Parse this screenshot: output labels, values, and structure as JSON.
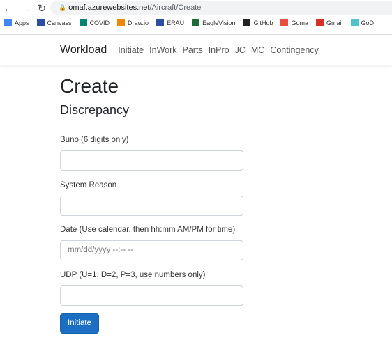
{
  "browser": {
    "url_host": "omaf.azurewebsites.net",
    "url_path": "/Aircraft/Create",
    "bookmarks": [
      {
        "label": "Apps",
        "color": "#4285f4"
      },
      {
        "label": "Canvass",
        "color": "#2b4ea2"
      },
      {
        "label": "COVID",
        "color": "#008373"
      },
      {
        "label": "Draw.io",
        "color": "#f08705"
      },
      {
        "label": "ERAU",
        "color": "#2b4ea2"
      },
      {
        "label": "EagleVision",
        "color": "#1e6b3a"
      },
      {
        "label": "GitHub",
        "color": "#222"
      },
      {
        "label": "Goma",
        "color": "#e84d3d"
      },
      {
        "label": "Gmail",
        "color": "#d93025"
      },
      {
        "label": "GoD",
        "color": "#4fc3c8"
      }
    ]
  },
  "nav": {
    "brand": "Workload",
    "items": [
      "Initiate",
      "InWork",
      "Parts",
      "InPro",
      "JC",
      "MC",
      "Contingency"
    ]
  },
  "page": {
    "title": "Create",
    "subtitle": "Discrepancy"
  },
  "form": {
    "fields": [
      {
        "label": "Buno (6 digits only)",
        "value": ""
      },
      {
        "label": "System Reason",
        "value": ""
      },
      {
        "label": "Date (Use calendar, then hh:mm AM/PM for time)",
        "placeholder": "mm/dd/yyyy --:-- --"
      },
      {
        "label": "UDP (U=1, D=2, P=3, use numbers only)",
        "value": ""
      }
    ],
    "submit": "Initiate"
  }
}
